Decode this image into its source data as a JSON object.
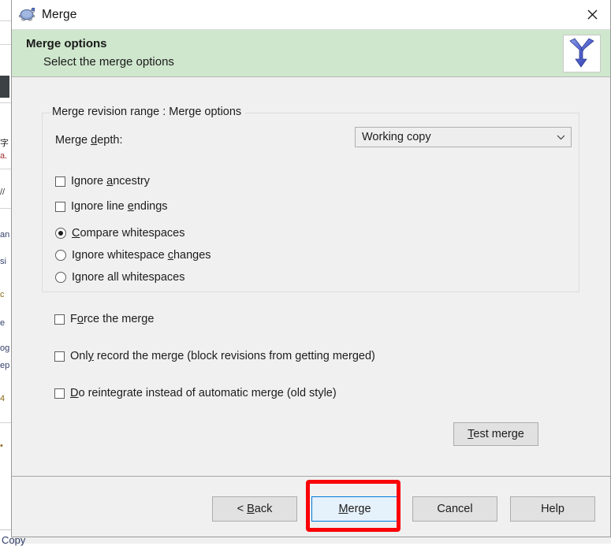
{
  "window": {
    "title": "Merge",
    "icon": "tortoise-icon",
    "close_label": "✕"
  },
  "header": {
    "title": "Merge options",
    "subtitle": "Select the merge options",
    "icon": "merge-arrows-icon"
  },
  "group": {
    "legend": "Merge revision range : Merge options"
  },
  "depth": {
    "label_prefix": "Merge ",
    "label_accel": "d",
    "label_suffix": "epth:",
    "selected": "Working copy",
    "arrow": "⌄",
    "options": [
      "Working copy"
    ]
  },
  "checkboxes_top": [
    {
      "name": "ignore-ancestry",
      "prefix": "Ignore ",
      "accel": "a",
      "suffix": "ncestry",
      "checked": false
    },
    {
      "name": "ignore-line-endings",
      "prefix": "Ignore line ",
      "accel": "e",
      "suffix": "ndings",
      "checked": false
    }
  ],
  "radios": [
    {
      "name": "compare-whitespaces",
      "prefix": "",
      "accel": "C",
      "suffix": "ompare whitespaces",
      "checked": true
    },
    {
      "name": "ignore-whitespace-changes",
      "prefix": "Ignore whitespace ",
      "accel": "c",
      "suffix": "hanges",
      "checked": false
    },
    {
      "name": "ignore-all-whitespaces",
      "prefix": "I",
      "accel": "g",
      "suffix": "nore all whitespaces",
      "checked": false
    }
  ],
  "checkboxes_bottom": [
    {
      "name": "force-the-merge",
      "prefix": "F",
      "accel": "o",
      "suffix": "rce the merge",
      "checked": false
    },
    {
      "name": "only-record-the-merge",
      "prefix": "Onl",
      "accel": "y",
      "suffix": " record the merge (block revisions from getting merged)",
      "checked": false
    },
    {
      "name": "do-reintegrate",
      "prefix": "",
      "accel": "D",
      "suffix": "o reintegrate instead of automatic merge (old style)",
      "checked": false
    }
  ],
  "test_merge": {
    "accel": "T",
    "suffix": "est merge"
  },
  "buttons": {
    "back": {
      "prefix": "< ",
      "accel": "B",
      "suffix": "ack"
    },
    "merge": {
      "prefix": "",
      "accel": "M",
      "suffix": "erge",
      "highlighted": true
    },
    "cancel": {
      "label": "Cancel"
    },
    "help": {
      "label": "Help"
    }
  },
  "background": {
    "bottom_text": "Copy",
    "edge_fragments": [
      "字",
      "a.",
      "//",
      "an",
      "si",
      "c",
      "e",
      "og",
      "ep",
      "4",
      "•"
    ],
    "accent_red": "#c01c1c",
    "dark_block": "#3b4145"
  },
  "colors": {
    "header_green": "#cfe7cd",
    "annotation_red": "#fb0007",
    "focus_blue": "#0078d7",
    "dialog_face": "#f0f0f0"
  }
}
